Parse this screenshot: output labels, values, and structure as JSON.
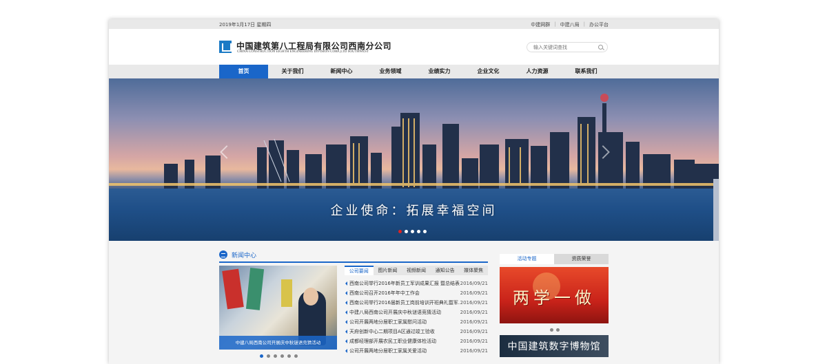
{
  "topbar": {
    "date": "2019年1月17日 星期四",
    "links": [
      "中建网群",
      "中建八局",
      "办公平台"
    ]
  },
  "header": {
    "company_cn": "中国建筑第八工程局有限公司西南分公司",
    "company_en": "CHINA CONSTRUCTION EIGHTH ENGINEERING DIVISION CORP.,LTD SOUTHWEST",
    "search_placeholder": "输入关键词查找"
  },
  "nav": {
    "items": [
      "首页",
      "关于我们",
      "新闻中心",
      "业务领域",
      "业绩实力",
      "企业文化",
      "人力资源",
      "联系我们"
    ],
    "active": "首页"
  },
  "banner": {
    "slogan": "企业使命：拓展幸福空间",
    "slide_count": 5,
    "active_slide": 1
  },
  "news": {
    "section_title": "新闻中心",
    "photo_caption": "中建八局西南公司开展庆中秋谜语竞猜活动",
    "photo_slide_count": 6,
    "tabs": [
      "公司要闻",
      "图片新闻",
      "视频新闻",
      "通知公告",
      "媒体聚焦"
    ],
    "active_tab": "公司要闻",
    "items": [
      {
        "title": "西南公司举行2016年新员工军训成果汇报 暨总结表...",
        "date": "2016/09/21"
      },
      {
        "title": "西南公司召开2016年年中工作会",
        "date": "2016/09/21"
      },
      {
        "title": "西南公司举行2016届新员工岗前培训开班典礼暨军...",
        "date": "2016/09/21"
      },
      {
        "title": "中建八局西南公司开展庆中秋谜语竞猜活动",
        "date": "2016/09/21"
      },
      {
        "title": "公司开展两地分居职工家属慰问活动",
        "date": "2016/09/21"
      },
      {
        "title": "天府创新中心二期项目A区通过竣工验收",
        "date": "2016/09/21"
      },
      {
        "title": "成都经理部开展农民工职业健康体检活动",
        "date": "2016/09/21"
      },
      {
        "title": "公司开展两地分居职工家属关爱活动",
        "date": "2016/09/21"
      }
    ]
  },
  "side": {
    "tabs": [
      "活动专题",
      "资质荣誉"
    ],
    "active_tab": "活动专题",
    "ad1_text": "两学一做",
    "ad2_text": "中国建筑数字博物馆"
  },
  "colors": {
    "brand_blue": "#1a66c9",
    "accent_red": "#d22222"
  }
}
